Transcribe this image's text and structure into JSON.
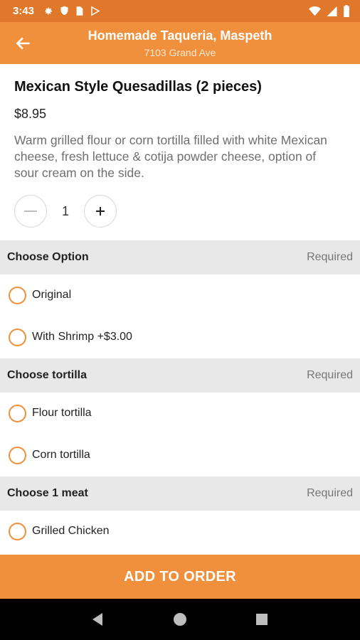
{
  "status_bar": {
    "time": "3:43",
    "left_icons": [
      "settings-icon",
      "shield-icon",
      "sim-card-icon",
      "play-store-icon"
    ],
    "right_icons": [
      "wifi-icon",
      "signal-icon",
      "battery-icon"
    ]
  },
  "header": {
    "title": "Homemade Taqueria, Maspeth",
    "subtitle": "7103 Grand Ave"
  },
  "item": {
    "name": "Mexican Style Quesadillas (2 pieces)",
    "price": "$8.95",
    "description": "Warm grilled flour or corn tortilla filled with white Mexican cheese, fresh lettuce & cotija powder cheese, option of sour cream on the side.",
    "quantity": "1"
  },
  "sections": [
    {
      "title": "Choose Option",
      "required_label": "Required",
      "options": [
        "Original",
        "With Shrimp +$3.00"
      ]
    },
    {
      "title": "Choose tortilla",
      "required_label": "Required",
      "options": [
        "Flour tortilla",
        "Corn tortilla"
      ]
    },
    {
      "title": "Choose 1 meat",
      "required_label": "Required",
      "options": [
        "Grilled Chicken"
      ]
    }
  ],
  "add_button": {
    "label": "ADD TO ORDER"
  },
  "colors": {
    "brand": "#f0903c",
    "status_bar": "#e0782c",
    "section_bg": "#e8e8e8"
  }
}
